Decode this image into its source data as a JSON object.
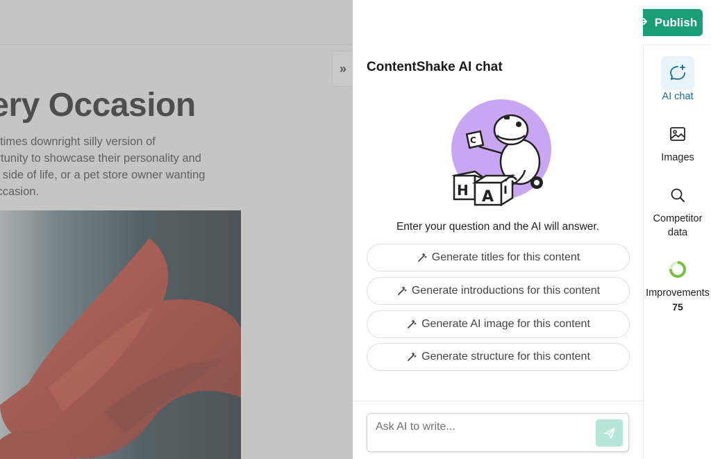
{
  "editor": {
    "title": "very Occasion",
    "body_lines": [
      "ometimes downright silly version of",
      "pportunity to showcase their personality and",
      "hine side of life, or a pet store owner wanting",
      "ry occasion."
    ],
    "collapse_glyph": "»"
  },
  "header": {
    "publish_label": "Publish"
  },
  "chat": {
    "title": "ContentShake AI chat",
    "intro": "Enter your question and the AI will answer.",
    "illustration_letters": [
      "H",
      "A",
      "I",
      "C"
    ],
    "suggestions": [
      "Generate titles for this content",
      "Generate introductions for this content",
      "Generate AI image for this content",
      "Generate structure for this content"
    ],
    "input_placeholder": "Ask AI to write..."
  },
  "rail": {
    "items": [
      {
        "label": "AI chat",
        "icon": "chat-sparkle-icon",
        "active": true
      },
      {
        "label": "Images",
        "icon": "image-icon",
        "active": false
      },
      {
        "label": "Competitor data",
        "icon": "search-icon",
        "active": false
      },
      {
        "label": "Improvements",
        "icon": "progress-ring-icon",
        "active": false,
        "value": "75"
      }
    ]
  },
  "colors": {
    "accent": "#189f7a",
    "send_button": "#b6e6d7",
    "active_rail_bg": "#e8f3fa",
    "active_rail_text": "#1a6a95",
    "illustration_circle": "#c9a6f2",
    "score_ring": "#7ac142"
  }
}
